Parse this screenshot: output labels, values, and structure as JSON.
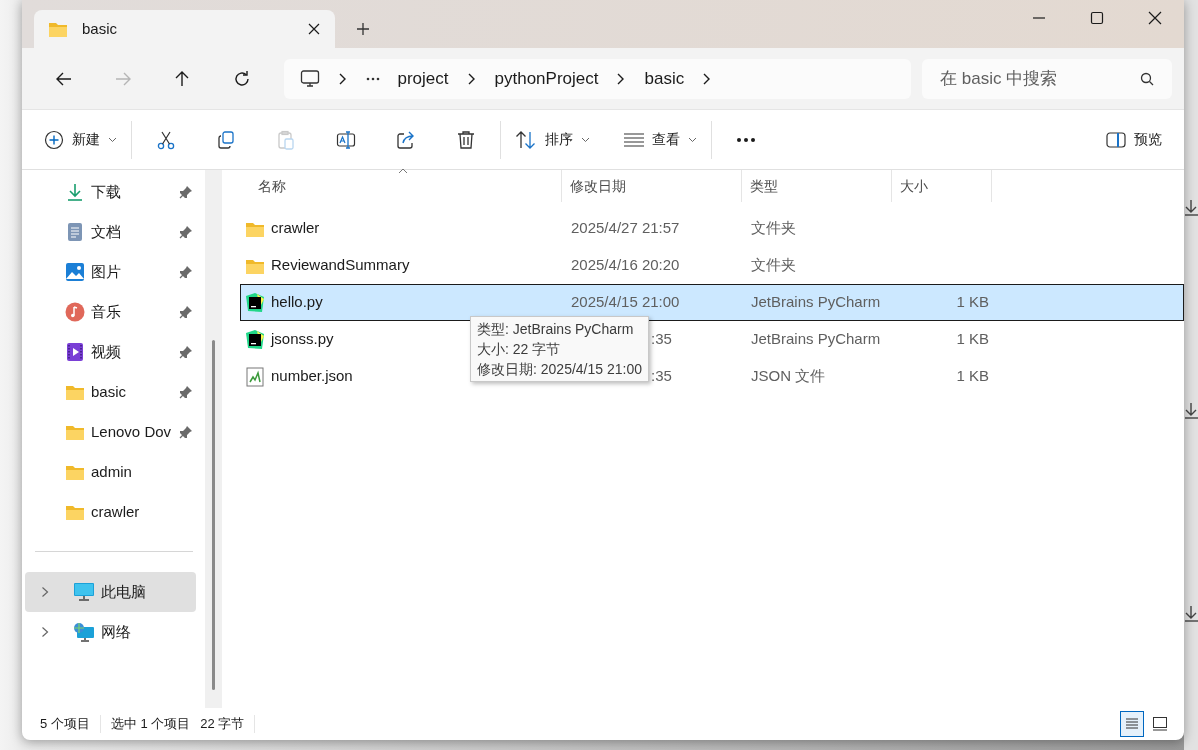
{
  "tab": {
    "title": "basic",
    "selected": true
  },
  "nav": [
    {
      "kind": "back",
      "disabled": false
    },
    {
      "kind": "forward",
      "disabled": true
    },
    {
      "kind": "up",
      "disabled": false
    },
    {
      "kind": "refresh",
      "disabled": false
    }
  ],
  "address": {
    "crumbs": [
      "project",
      "pythonProject",
      "basic"
    ]
  },
  "search": {
    "placeholder": "在 basic 中搜索"
  },
  "toolbar": {
    "new_label": "新建",
    "sort_label": "排序",
    "view_label": "查看",
    "preview_label": "预览",
    "actions": [
      {
        "kind": "cut",
        "disabled": false
      },
      {
        "kind": "copy",
        "disabled": false
      },
      {
        "kind": "paste",
        "disabled": true
      },
      {
        "kind": "rename",
        "disabled": false
      },
      {
        "kind": "share",
        "disabled": false
      },
      {
        "kind": "delete",
        "disabled": false
      }
    ]
  },
  "sidebar": {
    "quick_access": [
      {
        "label": "下载",
        "kind": "download",
        "pinned": true
      },
      {
        "label": "文档",
        "kind": "document",
        "pinned": true
      },
      {
        "label": "图片",
        "kind": "pictures",
        "pinned": true
      },
      {
        "label": "音乐",
        "kind": "music",
        "pinned": true
      },
      {
        "label": "视频",
        "kind": "video",
        "pinned": true
      },
      {
        "label": "basic",
        "kind": "folder",
        "pinned": true
      },
      {
        "label": "Lenovo Dov",
        "kind": "folder",
        "pinned": true
      },
      {
        "label": "admin",
        "kind": "folder",
        "pinned": false
      },
      {
        "label": "crawler",
        "kind": "folder",
        "pinned": false
      }
    ],
    "locations": [
      {
        "label": "此电脑",
        "kind": "pc",
        "selected": true
      },
      {
        "label": "网络",
        "kind": "network",
        "selected": false
      }
    ]
  },
  "table": {
    "columns": [
      "名称",
      "修改日期",
      "类型",
      "大小"
    ],
    "rows": [
      {
        "name": "crawler",
        "kind": "folder",
        "date": "2025/4/27 21:57",
        "type": "文件夹",
        "size": "",
        "selected": false,
        "covered": false
      },
      {
        "name": "ReviewandSummary",
        "kind": "folder",
        "date": "2025/4/16 20:20",
        "type": "文件夹",
        "size": "",
        "selected": false,
        "covered": false
      },
      {
        "name": "hello.py",
        "kind": "pycharm",
        "date": "2025/4/15 21:00",
        "type": "JetBrains PyCharm",
        "size": "1 KB",
        "selected": true,
        "covered": false
      },
      {
        "name": "jsonss.py",
        "kind": "pycharm",
        "date": ":35",
        "type": "JetBrains PyCharm",
        "size": "1 KB",
        "selected": false,
        "covered": true
      },
      {
        "name": "number.json",
        "kind": "json",
        "date": ":35",
        "type": "JSON 文件",
        "size": "1 KB",
        "selected": false,
        "covered": true
      }
    ]
  },
  "tooltip": {
    "lines": [
      "类型: JetBrains PyCharm",
      "大小: 22 字节",
      "修改日期: 2025/4/15 21:00"
    ]
  },
  "status_bar": {
    "count": "5 个项目",
    "selection": "选中 1 个项目",
    "selection_size": "22 字节",
    "views": [
      {
        "kind": "details",
        "selected": true
      },
      {
        "kind": "tiles",
        "selected": false
      }
    ]
  }
}
